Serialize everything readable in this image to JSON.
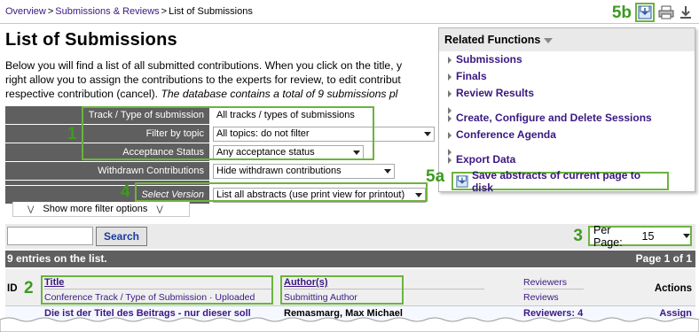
{
  "breadcrumb": {
    "overview": "Overview",
    "submissions_reviews": "Submissions & Reviews",
    "current": "List of Submissions",
    "separator": ">"
  },
  "toolbar": {
    "tag_5b": "5b",
    "icons": [
      "save-to-disk-icon",
      "print-icon",
      "download-icon"
    ]
  },
  "page_title": "List of Submissions",
  "intro": {
    "line1": "Below you will find a list of all submitted contributions. When you click on the title, y",
    "line2": "right allow you to assign the contributions to the experts for review, to edit contribut",
    "line3_plain": "respective contribution (cancel). ",
    "line3_italic": "The database contains a total of 9 submissions pl"
  },
  "related_functions": {
    "header": "Related Functions",
    "group1": [
      "Submissions",
      "Finals",
      "Review Results"
    ],
    "group2": [
      "Create, Configure and Delete Sessions",
      "Conference Agenda"
    ],
    "group3": [
      "Export Data"
    ],
    "save_label": "Save abstracts of current page to disk",
    "tag_5a": "5a"
  },
  "filters": {
    "tag_1": "1",
    "tag_4": "4",
    "track_label": "Track / Type of submission",
    "track_value": "All tracks / types of submissions",
    "topic_label": "Filter by topic",
    "topic_value": "All topics: do not filter",
    "acceptance_label": "Acceptance Status",
    "acceptance_value": "Any acceptance status",
    "withdrawn_label": "Withdrawn Contributions",
    "withdrawn_value": "Hide withdrawn contributions",
    "version_label": "Select Version",
    "version_value": "List all abstracts (use print view for printout)",
    "more_filters": "Show more filter options"
  },
  "search": {
    "input_value": "",
    "button_label": "Search",
    "tag_3": "3",
    "per_page_label": "Per Page:",
    "per_page_value": "15"
  },
  "summary": {
    "entries": "9 entries on the list.",
    "page": "Page 1 of 1"
  },
  "table": {
    "tag_2": "2",
    "col_id": "ID",
    "col_title": "Title",
    "col_track": "Conference Track / Type of Submission · Uploaded",
    "col_author": "Author(s)",
    "col_submitting": "Submitting Author",
    "col_reviewers": "Reviewers",
    "col_reviews": "Reviews",
    "col_actions": "Actions",
    "rows": [
      {
        "title": "Die ist der Titel des Beitrags - nur dieser soll",
        "author": "Remasmarg, Max Michael",
        "reviewers": "Reviewers: 4",
        "action": "Assign"
      }
    ]
  },
  "colors": {
    "highlight_green": "#6db33f",
    "tag_green": "#3d9b1f",
    "link_purple": "#3a1880",
    "label_grey": "#5f5f5f"
  }
}
